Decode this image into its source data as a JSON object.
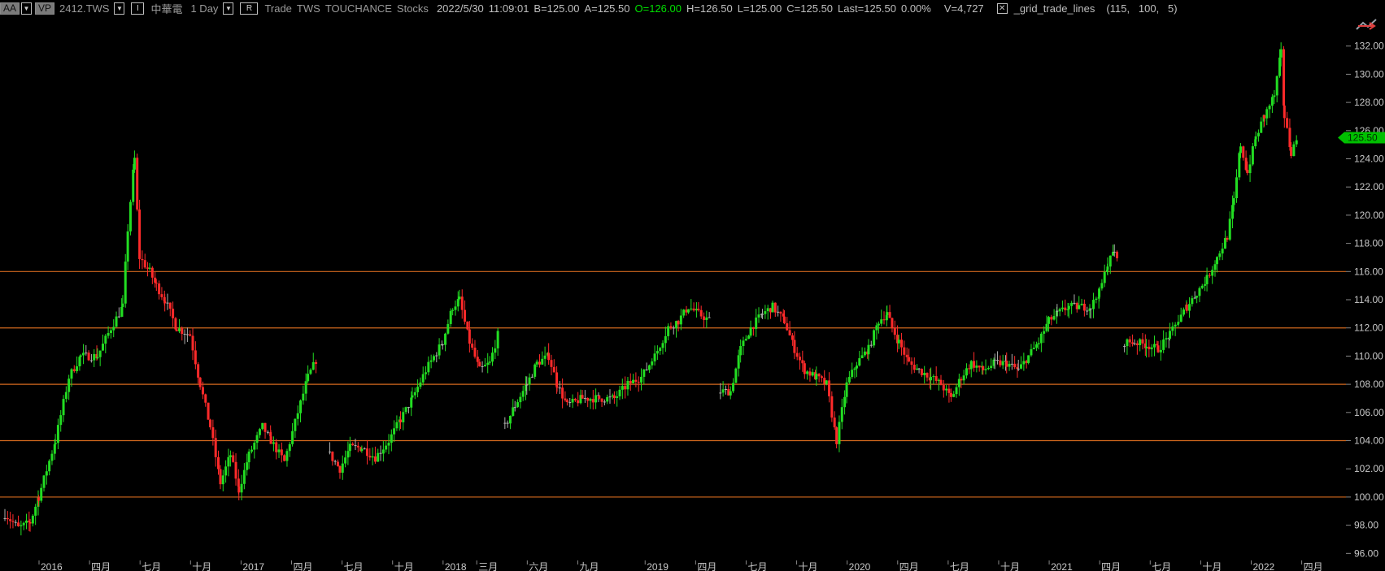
{
  "toolbar": {
    "aa_label": "AA",
    "vp_label": "VP",
    "symbol": "2412.TWS",
    "i_label": "I",
    "name": "中華電",
    "interval": "1 Day",
    "r_label": "R",
    "trade": "Trade",
    "exchange": "TWS",
    "source": "TOUCHANCE",
    "category": "Stocks",
    "date": "2022/5/30",
    "time": "11:09:01",
    "bid": "B=125.00",
    "ask": "A=125.50",
    "open": "O=126.00",
    "high": "H=126.50",
    "low": "L=125.00",
    "close": "C=125.50",
    "last": "Last=125.50",
    "change": "0.00%",
    "volume": "V=4,727",
    "indicator_name": "_grid_trade_lines",
    "indicator_params": "(115,   100,   5)"
  },
  "colors": {
    "background": "#000000",
    "grid_line": "#d2691e",
    "up": "#22dd22",
    "down": "#ff2a2a",
    "neutral": "#b0b0b0",
    "price_tag": "#00c000",
    "axis_text": "#c8c8c8"
  },
  "chart_data": {
    "type": "candlestick",
    "ylim": [
      95.5,
      134
    ],
    "y_ticks": [
      "96.00",
      "98.00",
      "100.00",
      "102.00",
      "104.00",
      "106.00",
      "108.00",
      "110.00",
      "112.00",
      "114.00",
      "116.00",
      "118.00",
      "120.00",
      "122.00",
      "124.00",
      "126.00",
      "128.00",
      "130.00",
      "132.00"
    ],
    "y_tick_values": [
      96,
      98,
      100,
      102,
      104,
      106,
      108,
      110,
      112,
      114,
      116,
      118,
      120,
      122,
      124,
      126,
      128,
      130,
      132
    ],
    "x_ticks": [
      "2016",
      "四月",
      "七月",
      "十月",
      "2017",
      "四月",
      "七月",
      "十月",
      "2018",
      "三月",
      "六月",
      "九月",
      "2019",
      "四月",
      "七月",
      "十月",
      "2020",
      "四月",
      "七月",
      "十月",
      "2021",
      "四月",
      "七月",
      "十月",
      "2022",
      "四月"
    ],
    "x_tick_months": [
      0,
      3,
      6,
      9,
      12,
      15,
      18,
      21,
      24,
      26,
      29,
      32,
      36,
      39,
      42,
      45,
      48,
      51,
      54,
      57,
      60,
      63,
      66,
      69,
      72,
      75
    ],
    "horizontal_lines": [
      100,
      104,
      108,
      112,
      116
    ],
    "current_price": "125.50",
    "current_price_value": 125.5,
    "months_span": 77,
    "price_path": [
      [
        0,
        98.8
      ],
      [
        0.8,
        97.8
      ],
      [
        1.5,
        98.2
      ],
      [
        2,
        100
      ],
      [
        3,
        104
      ],
      [
        3.8,
        108.5
      ],
      [
        4.5,
        110
      ],
      [
        5.5,
        110
      ],
      [
        6.3,
        112
      ],
      [
        7,
        113.5
      ],
      [
        7.3,
        119
      ],
      [
        7.7,
        124
      ],
      [
        8,
        117
      ],
      [
        8.6,
        116
      ],
      [
        9,
        115
      ],
      [
        9.5,
        114
      ],
      [
        10.2,
        112
      ],
      [
        11,
        111.5
      ],
      [
        11.6,
        108
      ],
      [
        12.2,
        105
      ],
      [
        12.8,
        101
      ],
      [
        13.4,
        103
      ],
      [
        13.9,
        100.5
      ],
      [
        14.5,
        103
      ],
      [
        15.3,
        105
      ],
      [
        15.8,
        104
      ],
      [
        16.6,
        102.5
      ],
      [
        17.4,
        106
      ],
      [
        18,
        108.5
      ],
      [
        18.6,
        110
      ],
      [
        null,
        null
      ],
      [
        19.3,
        103
      ],
      [
        19.9,
        102
      ],
      [
        20.5,
        103.5
      ],
      [
        21.2,
        103.5
      ],
      [
        22,
        102.8
      ],
      [
        22.8,
        104
      ],
      [
        23.5,
        105.5
      ],
      [
        24.2,
        107
      ],
      [
        25,
        109
      ],
      [
        26,
        111
      ],
      [
        26.6,
        113.5
      ],
      [
        27,
        114
      ],
      [
        27.6,
        111
      ],
      [
        28.2,
        109
      ],
      [
        28.8,
        109.5
      ],
      [
        29.4,
        112
      ],
      [
        null,
        null
      ],
      [
        29.7,
        105
      ],
      [
        30.3,
        106.5
      ],
      [
        31,
        108
      ],
      [
        31.6,
        109.5
      ],
      [
        32.3,
        110
      ],
      [
        32.8,
        108
      ],
      [
        33.4,
        106.5
      ],
      [
        34.3,
        107
      ],
      [
        35.3,
        107
      ],
      [
        36.2,
        107
      ],
      [
        37,
        108
      ],
      [
        37.8,
        108.5
      ],
      [
        38.6,
        110
      ],
      [
        39.4,
        112
      ],
      [
        40,
        112.5
      ],
      [
        40.6,
        113.5
      ],
      [
        41.2,
        113
      ],
      [
        41.9,
        112.5
      ],
      [
        null,
        null
      ],
      [
        42.5,
        107.5
      ],
      [
        43.1,
        107.5
      ],
      [
        43.7,
        110.5
      ],
      [
        44.3,
        112
      ],
      [
        45,
        113
      ],
      [
        45.6,
        113.5
      ],
      [
        46.3,
        112.5
      ],
      [
        46.9,
        110.5
      ],
      [
        47.5,
        109
      ],
      [
        48.2,
        108.5
      ],
      [
        48.8,
        108
      ],
      [
        49.4,
        104
      ],
      [
        50,
        108
      ],
      [
        50.6,
        109.5
      ],
      [
        51.3,
        110.5
      ],
      [
        51.9,
        112.5
      ],
      [
        52.4,
        113
      ],
      [
        52.7,
        112
      ],
      [
        53.1,
        111
      ],
      [
        53.7,
        109.5
      ],
      [
        54.3,
        109
      ],
      [
        55,
        108.5
      ],
      [
        55.6,
        108
      ],
      [
        56.2,
        107
      ],
      [
        56.8,
        108.5
      ],
      [
        57.4,
        109.5
      ],
      [
        58.1,
        109
      ],
      [
        58.8,
        109.5
      ],
      [
        59.5,
        109.5
      ],
      [
        60.2,
        109
      ],
      [
        60.8,
        110
      ],
      [
        61.4,
        111
      ],
      [
        62,
        112.5
      ],
      [
        62.5,
        113
      ],
      [
        63.2,
        113.5
      ],
      [
        63.8,
        113.5
      ],
      [
        64.5,
        113.5
      ],
      [
        65,
        114.5
      ],
      [
        65.5,
        116.5
      ],
      [
        65.9,
        117.5
      ],
      [
        66.2,
        116
      ],
      [
        null,
        null
      ],
      [
        66.5,
        111
      ],
      [
        67.1,
        111
      ],
      [
        67.8,
        110.8
      ],
      [
        68.5,
        110.5
      ],
      [
        69.2,
        111.5
      ],
      [
        69.7,
        112.5
      ],
      [
        70.2,
        113.5
      ],
      [
        70.8,
        114.5
      ],
      [
        71.4,
        115.5
      ],
      [
        72,
        117
      ],
      [
        72.6,
        118.5
      ],
      [
        73,
        121
      ],
      [
        73.4,
        125
      ],
      [
        73.8,
        123
      ],
      [
        74.3,
        125.5
      ],
      [
        74.8,
        127
      ],
      [
        75.4,
        128.5
      ],
      [
        75.8,
        131.5
      ],
      [
        76,
        127
      ],
      [
        76.4,
        124.5
      ],
      [
        76.8,
        125.5
      ]
    ]
  }
}
